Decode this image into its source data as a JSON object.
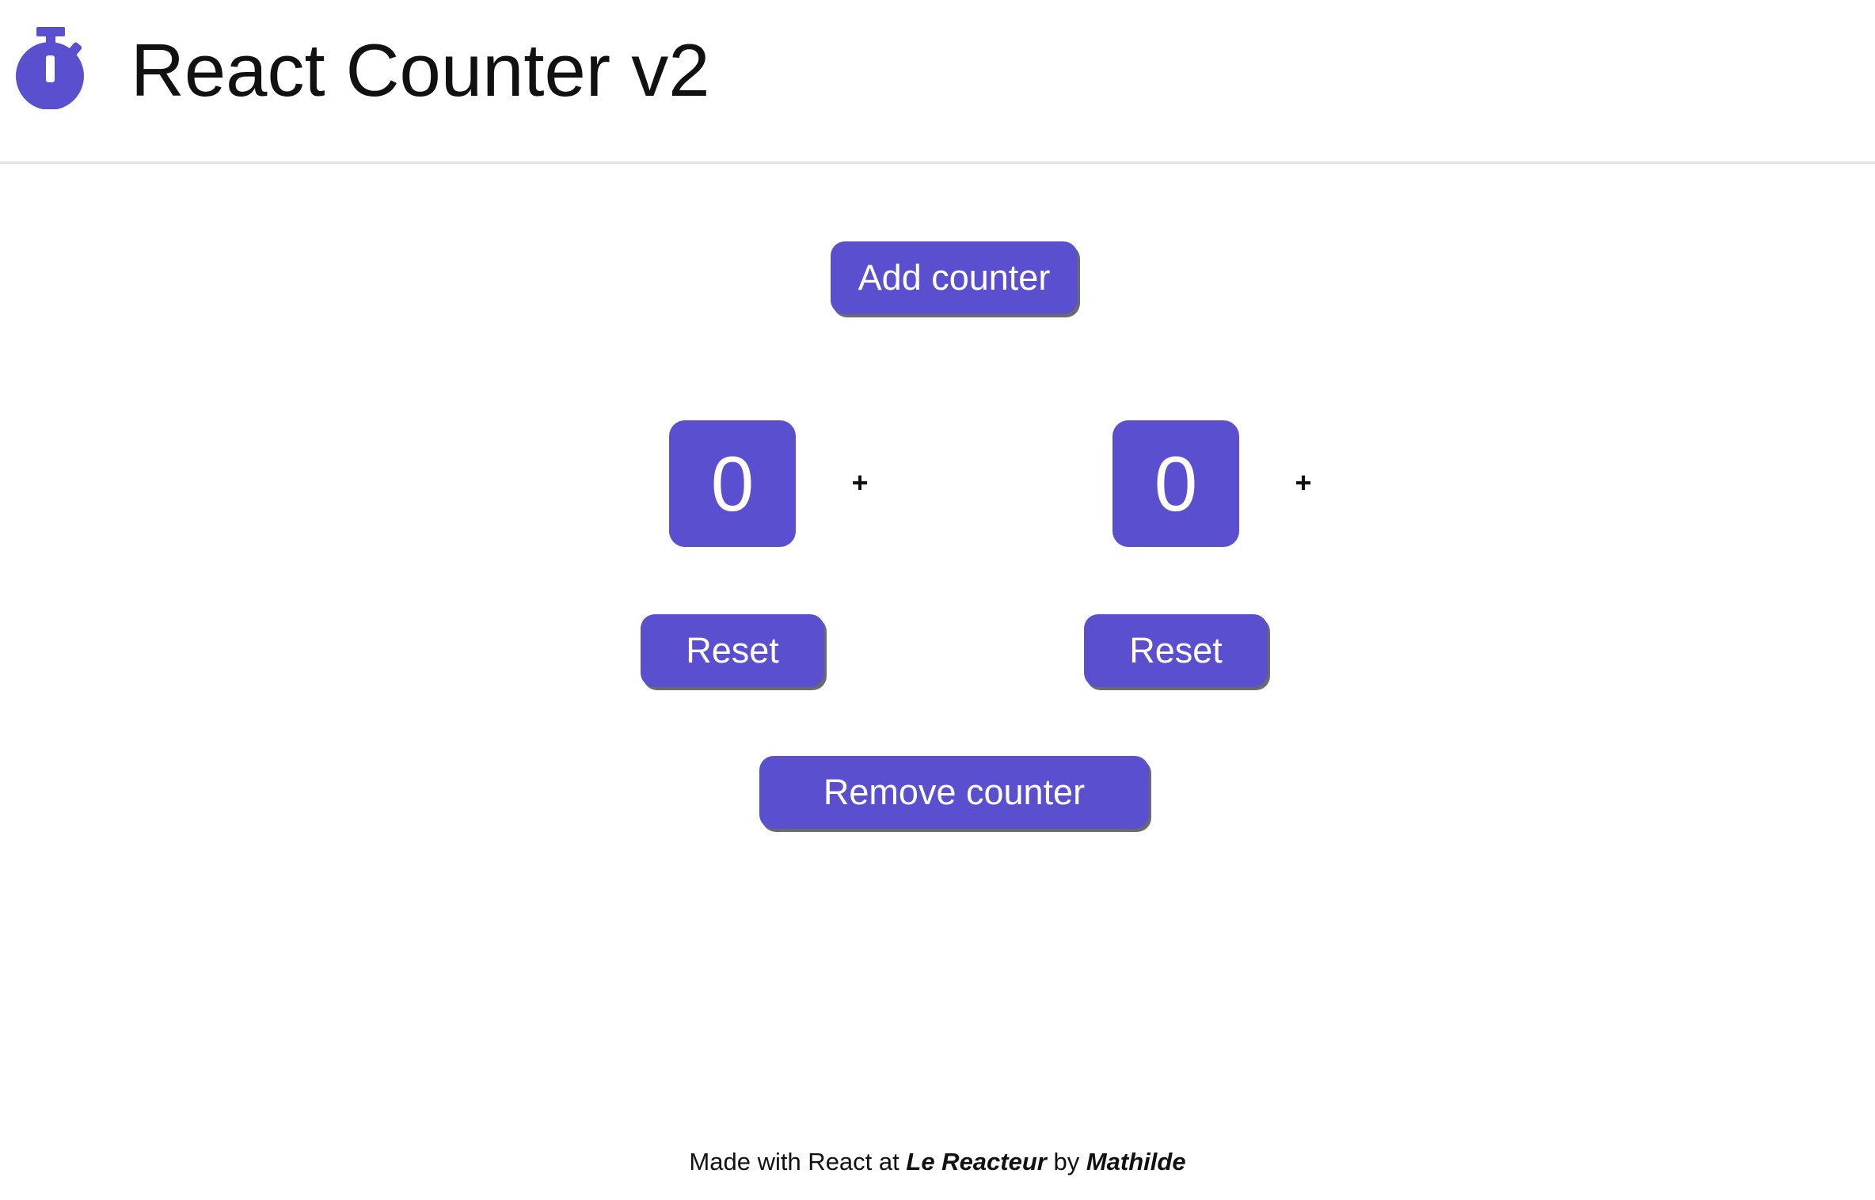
{
  "header": {
    "title": "React Counter v2",
    "logo_icon": "stopwatch-icon"
  },
  "controls": {
    "add_label": "Add counter",
    "remove_label": "Remove counter"
  },
  "counters": [
    {
      "value": "0",
      "increment_label": "+",
      "reset_label": "Reset"
    },
    {
      "value": "0",
      "increment_label": "+",
      "reset_label": "Reset"
    }
  ],
  "footer": {
    "prefix": "Made with React at",
    "school": "Le Reacteur",
    "by": "by",
    "author": "Mathilde"
  },
  "colors": {
    "accent": "#5a4fcf",
    "button_shadow": "#6b6b6b",
    "header_border": "#e2e2e2"
  }
}
